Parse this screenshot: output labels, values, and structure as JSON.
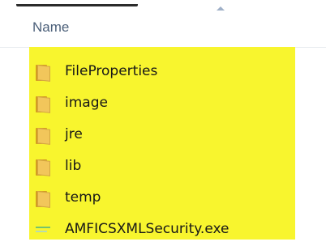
{
  "column_header": {
    "name_label": "Name"
  },
  "files": [
    {
      "name": "FileProperties",
      "icon": "folder-icon"
    },
    {
      "name": "image",
      "icon": "folder-icon"
    },
    {
      "name": "jre",
      "icon": "folder-icon"
    },
    {
      "name": "lib",
      "icon": "folder-icon"
    },
    {
      "name": "temp",
      "icon": "folder-icon"
    },
    {
      "name": "AMFICSXMLSecurity.exe",
      "icon": "exe-file-icon"
    }
  ],
  "colors": {
    "selection_highlight": "#f8f52e",
    "header_text": "#4c607a",
    "folder_fill": "#f2c65b",
    "folder_back": "#d49c21",
    "exe_accent": "#75c36d"
  }
}
